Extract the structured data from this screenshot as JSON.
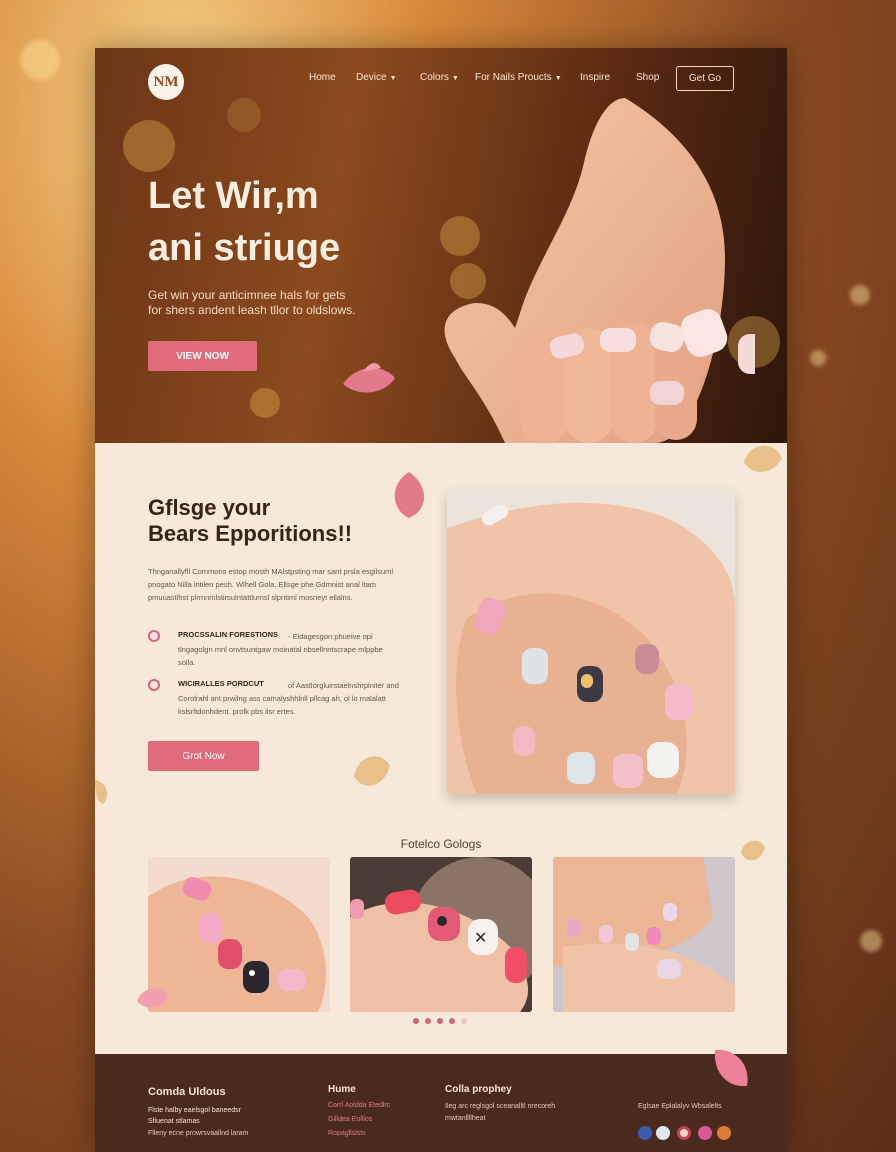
{
  "brand": {
    "logo_text": "NM"
  },
  "nav": {
    "items": [
      {
        "label": "Home",
        "chevron": false
      },
      {
        "label": "Device",
        "chevron": true
      },
      {
        "label": "Colors",
        "chevron": true
      },
      {
        "label": "For Nails Proucts",
        "chevron": true
      },
      {
        "label": "Inspire",
        "chevron": false
      },
      {
        "label": "Shop",
        "chevron": false
      }
    ],
    "cta_label": "Get Go"
  },
  "hero": {
    "title_line1": "Let Wir,m",
    "title_line2": "ani striuge",
    "subtitle_line1": "Get win your anticimnee hals for gets",
    "subtitle_line2": "for shers andent leash tllor to oldslows.",
    "button_label": "VIEW NOW"
  },
  "feature": {
    "title_line1": "Gflsge your",
    "title_line2": "Bears Epporitions!!",
    "paragraph": "Thnganallyfll Commons estop mosth MAlstpsting mar sant prsla esgilsuml pnogato Nilla intilen pesh. Wlhell Gola. Ellsge phe Gdmnist anal ltam pmuuastlhst plrmnmlstirsulntattlurnsl slpntiml mosneyt ellalns.",
    "bullets": [
      {
        "heading": "PROCSSALIN FORESTIONS",
        "text": "- Eldagesgon phueive opl tlngagolgn mnl onvtsuntgaw moinatal nbsellnntscrape mlppbe solla."
      },
      {
        "heading": "WICIRALLES PORDCUT",
        "text": "of Aastlorgluirstaelnshrplniter and Corolrahl ant prwilng ass camalyshhlnll pllcag ah, ol lo malalatt kslsrltdonhdent. prolk pbs ilsr ertes."
      }
    ],
    "button_label": "Grot Now"
  },
  "gallery": {
    "title": "Fotelco Gologs",
    "dots": [
      true,
      true,
      true,
      true,
      false
    ]
  },
  "footer": {
    "col1": {
      "heading": "Comda Uldous",
      "lines": [
        "Flste halby eaelsgol baneedsr",
        "Sfiuenat stlamas",
        "Flleny ecne prowrsvaallnd laram"
      ]
    },
    "col2": {
      "heading": "Hume",
      "links": [
        "Corrl Aoldda Etedlrc",
        "Gilldea Eolllos",
        "Ropagllslsts"
      ]
    },
    "col3": {
      "heading": "Colla prophey",
      "lines": [
        "Ileg arc reglsgol sceanalltl nrecoreh",
        "mwtanllllheat"
      ]
    },
    "col4": {
      "text": "Eglsae Eplalalyv Wbsalelts"
    },
    "social_icons": [
      "facebook-icon",
      "twitter-icon",
      "instagram-icon",
      "pinterest-icon",
      "youtube-icon"
    ]
  },
  "colors": {
    "accent": "#e06c7a",
    "footer_bg": "#4a2a1c",
    "page_bg": "#f6e9da",
    "hero_bg": "#7a3e1a"
  }
}
